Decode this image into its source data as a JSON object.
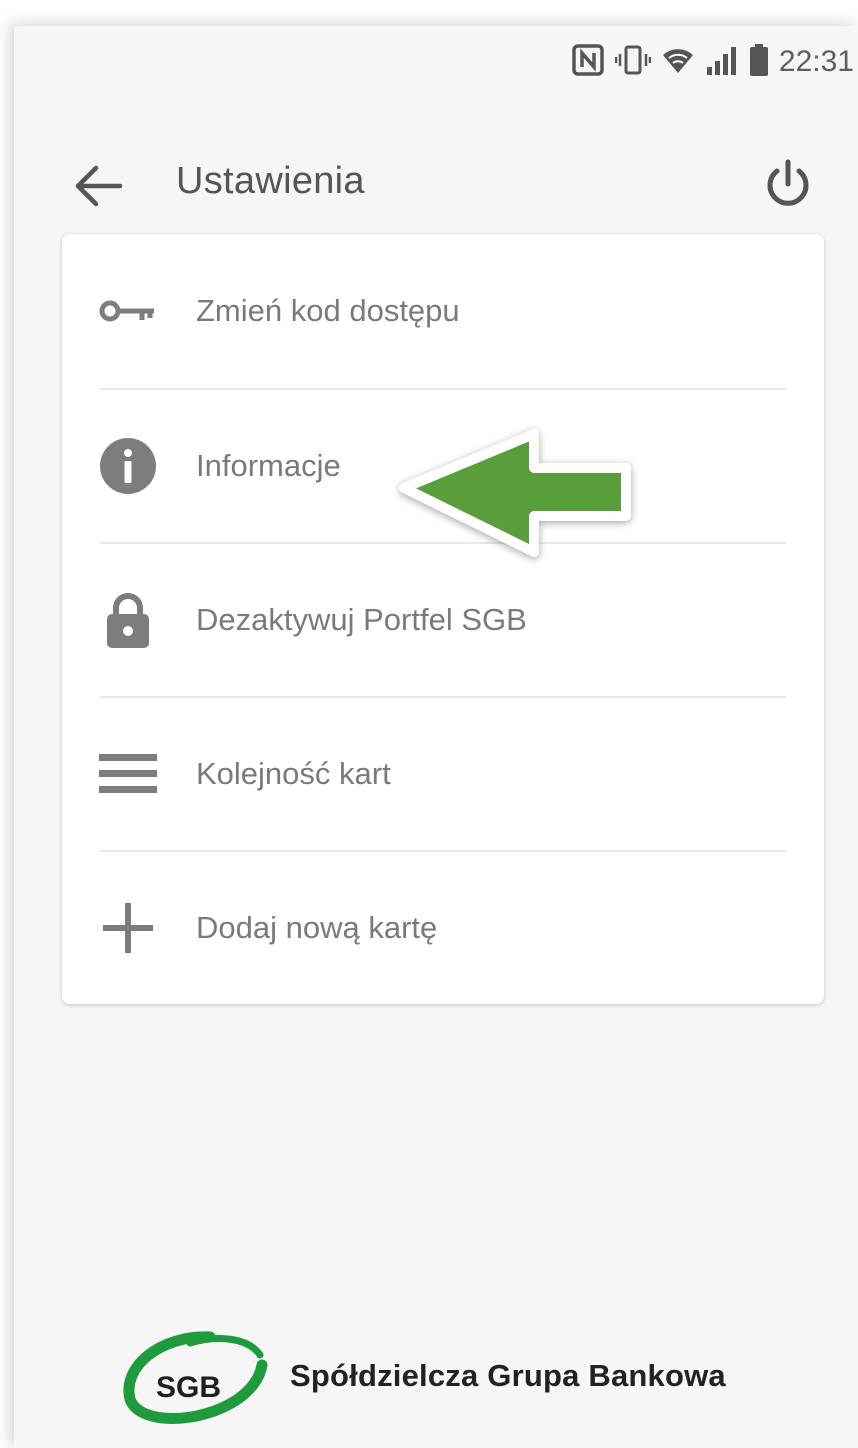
{
  "status_bar": {
    "time": "22:31",
    "icons": [
      "nfc-icon",
      "vibrate-icon",
      "wifi-icon",
      "signal-icon",
      "battery-icon"
    ]
  },
  "app_bar": {
    "title": "Ustawienia",
    "back_icon": "arrow-left-icon",
    "power_icon": "power-icon"
  },
  "menu": {
    "items": [
      {
        "label": "Zmień kod dostępu",
        "icon": "key-icon"
      },
      {
        "label": "Informacje",
        "icon": "info-icon"
      },
      {
        "label": "Dezaktywuj Portfel SGB",
        "icon": "lock-icon"
      },
      {
        "label": "Kolejność kart",
        "icon": "reorder-icon"
      },
      {
        "label": "Dodaj nową kartę",
        "icon": "plus-icon"
      }
    ]
  },
  "annotation": {
    "icon": "green-arrow-left-icon",
    "color": "#5a9e3c"
  },
  "footer": {
    "logo_text": "SGB",
    "brand_name": "Spółdzielcza Grupa Bankowa",
    "logo_color": "#1f9a3c"
  },
  "colors": {
    "icon_gray": "#7d7d7d",
    "text_gray": "#7a7a7a",
    "background": "#f6f6f6"
  }
}
